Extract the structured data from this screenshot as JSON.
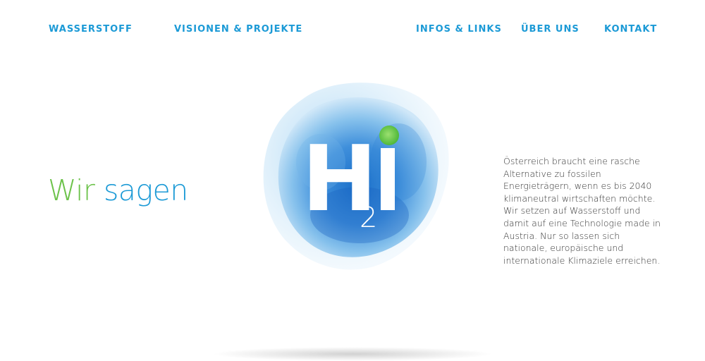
{
  "nav": {
    "items": [
      {
        "label": "WASSERSTOFF"
      },
      {
        "label": "VISIONEN & PROJEKTE"
      },
      {
        "label": "INFOS & LINKS"
      },
      {
        "label": "ÜBER UNS"
      },
      {
        "label": "KONTAKT"
      }
    ]
  },
  "hero": {
    "headline_part1": "Wir",
    "headline_part2": "sagen",
    "logo": {
      "letter_h": "H",
      "subscript": "2",
      "letter_i": "i"
    },
    "paragraph": "Österreich braucht eine rasche Alternative zu fossilen Energieträgern, wenn es bis 2040 klimaneutral wirtschaften möchte. Wir setzen auf Wasserstoff und damit auf eine Technologie made in Austria. Nur so lassen sich nationale, europäische und internationale Klimaziele erreichen."
  },
  "colors": {
    "accent_blue": "#1c9ad6",
    "accent_green": "#6cc24a",
    "text": "#333333"
  }
}
